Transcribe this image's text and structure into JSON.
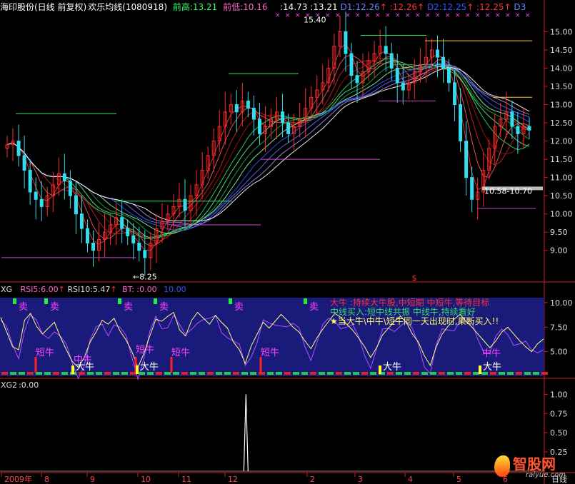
{
  "header": {
    "stock": "海印股份(日线 前复权)",
    "indicator": "欢乐均线(1080918)",
    "prev_high": "前高:13.21",
    "prev_low": "前低:10.16",
    "v1": ":14.73",
    "v2": ":13.21",
    "d1": "D1:12.26",
    "v3": ":12.26",
    "d2": "D2:12.25",
    "v4": ":12.25",
    "d3": "D3"
  },
  "main_annotations": {
    "high_label": "15.40",
    "low_label": "←8.25",
    "range_label": "10.58-10.70",
    "marker": "$"
  },
  "xg_header": {
    "name": "XG",
    "rsi5": "RSI5:6.00",
    "rsi10": "RSI10:5.47",
    "bt": "BT:",
    "bt_val": ":0.00",
    "bt_val2": "10.00"
  },
  "xg_labels": {
    "sell": "卖",
    "short_bull": "短牛",
    "mid_bull": "中牛",
    "big_bull": "大牛",
    "legend1": "大牛 :持续大牛股,中短期 中短牛,等待目标",
    "legend2": "中线买入:短中线共振 中线牛,持续看好",
    "legend3": "★当大牛\\中牛\\短牛同一天出现时,果断买入!!"
  },
  "xg2_header": {
    "name": "XG2",
    "value": ":0.00"
  },
  "axis": {
    "x_ticks": [
      "2009年",
      "8",
      "9",
      "10",
      "11",
      "12",
      "2",
      "3",
      "4",
      "5",
      "6"
    ],
    "unit_label": "日线"
  },
  "watermark": {
    "name": "智股网",
    "url": "raiyue.com"
  },
  "colors": {
    "up": "#ff2a2a",
    "down": "#22dd55",
    "panel": "#1a1a7a",
    "rsi5": "#ffff80",
    "rsi10": "#b050ff"
  },
  "chart_data": [
    {
      "type": "line",
      "name": "price-candlestick",
      "y_ticks": [
        9.0,
        9.5,
        10.0,
        10.5,
        11.0,
        11.5,
        12.0,
        12.5,
        13.0,
        13.5,
        14.0,
        14.5,
        15.0
      ],
      "ylim": [
        8.25,
        15.4
      ],
      "close": [
        11.9,
        12.0,
        11.6,
        11.2,
        10.6,
        10.4,
        10.2,
        10.5,
        10.8,
        11.1,
        10.9,
        10.5,
        10.0,
        9.6,
        9.2,
        9.0,
        9.3,
        9.5,
        9.7,
        9.9,
        9.6,
        9.4,
        9.2,
        9.0,
        8.8,
        9.2,
        9.6,
        9.8,
        10.0,
        10.2,
        10.4,
        10.1,
        10.5,
        10.8,
        11.2,
        11.6,
        12.0,
        12.4,
        12.8,
        13.0,
        12.8,
        13.1,
        12.9,
        12.6,
        12.2,
        12.4,
        12.6,
        12.8,
        12.5,
        12.2,
        12.4,
        12.6,
        12.9,
        13.2,
        13.4,
        13.6,
        14.0,
        14.6,
        15.0,
        14.4,
        13.8,
        13.6,
        13.9,
        14.2,
        14.4,
        14.6,
        14.4,
        14.0,
        13.6,
        13.4,
        13.6,
        13.9,
        14.1,
        14.3,
        14.5,
        14.3,
        14.0,
        13.6,
        13.0,
        12.0,
        11.0,
        10.4,
        10.6,
        11.2,
        11.8,
        12.4,
        12.6,
        12.8,
        12.4,
        12.2,
        12.4,
        12.3
      ],
      "ma_periods_count": 12
    },
    {
      "type": "line",
      "name": "XG",
      "series": [
        {
          "name": "RSI5"
        },
        {
          "name": "RSI10"
        }
      ],
      "y_ticks": [
        5.0,
        7.5,
        10.0
      ],
      "ylim": [
        2.5,
        10.5
      ],
      "values": [
        8.5,
        7.0,
        5.5,
        5.2,
        8.2,
        8.9,
        7.6,
        6.8,
        7.4,
        8.0,
        6.5,
        5.2,
        4.0,
        3.4,
        4.4,
        6.0,
        7.0,
        8.2,
        7.8,
        8.4,
        7.1,
        6.2,
        5.0,
        3.4,
        4.8,
        6.6,
        8.3,
        8.1,
        8.6,
        9.0,
        7.2,
        6.6,
        8.2,
        9.0,
        8.4,
        7.8,
        8.7,
        8.0,
        7.4,
        6.0,
        5.2,
        3.8,
        5.6,
        6.8,
        8.0,
        7.4,
        8.1,
        8.8,
        8.2,
        7.5,
        7.0,
        6.1,
        5.3,
        6.4,
        7.3,
        8.1,
        8.9,
        8.5,
        7.8,
        7.2,
        6.4,
        5.5,
        4.4,
        5.4,
        6.7,
        7.4,
        8.1,
        8.6,
        8.0,
        6.8,
        6.0,
        4.6,
        3.6,
        5.5,
        6.8,
        7.6,
        8.3,
        8.8,
        8.1,
        7.5,
        6.8,
        6.1,
        5.4,
        6.1,
        7.0,
        7.5,
        6.8,
        6.1,
        5.5,
        5.0,
        5.8,
        6.3
      ]
    },
    {
      "type": "line",
      "name": "XG2",
      "y_ticks": [
        0.25,
        0.5,
        0.75,
        1.0
      ],
      "ylim": [
        0,
        1.05
      ],
      "spike_index": 40,
      "spike_value": 1.0
    }
  ]
}
